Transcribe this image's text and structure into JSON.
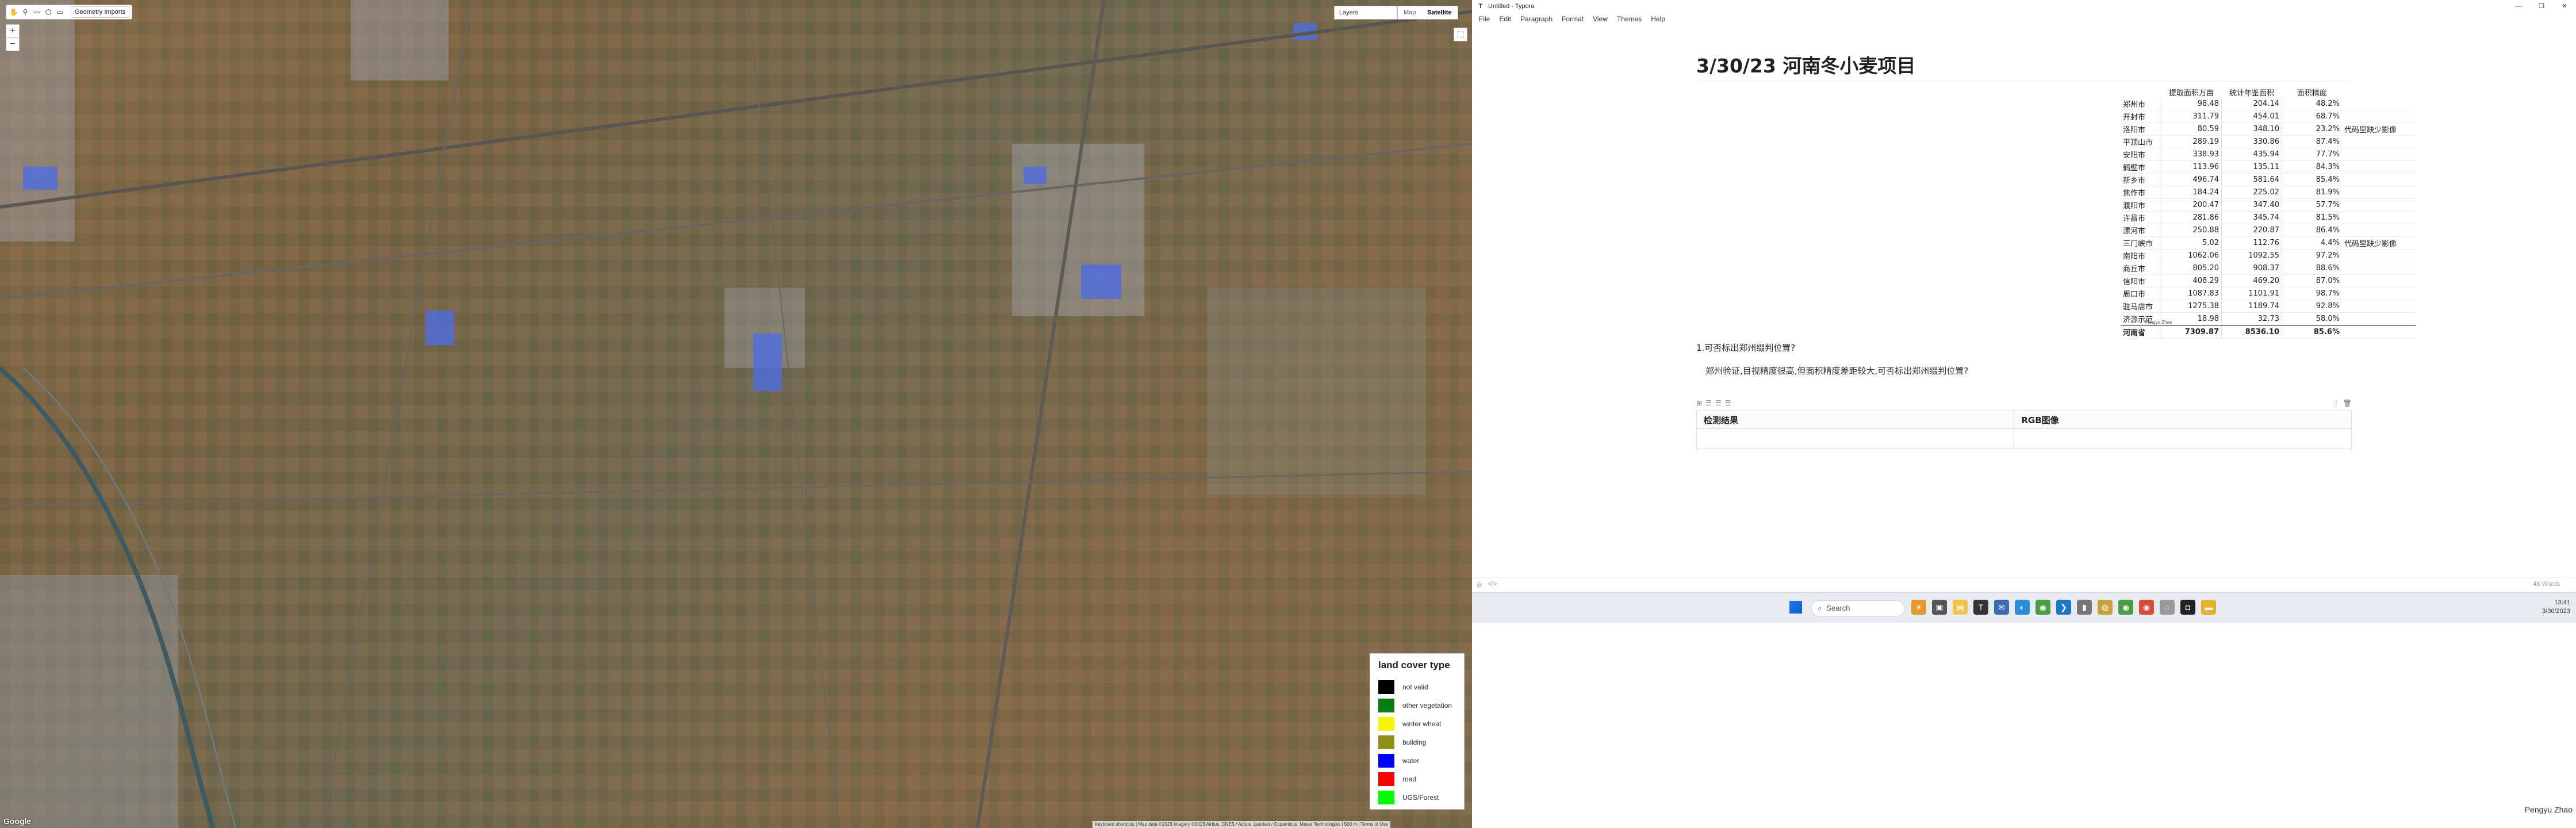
{
  "map": {
    "geometry_label": "Geometry Imports",
    "layers_label": "Layers",
    "map_label": "Map",
    "satellite_label": "Satellite",
    "zoom_in": "+",
    "zoom_out": "−",
    "google": "Google",
    "attribution": "Keyboard shortcuts | Map data ©2023 Imagery ©2023 Airbus, CNES / Airbus, Landsat / Copernicus, Maxar Technologies | 500 m | Terms of Use",
    "legend": {
      "title": "land cover type",
      "items": [
        {
          "label": "not valid",
          "color": "#000000"
        },
        {
          "label": "other vegetation",
          "color": "#0a7d12"
        },
        {
          "label": "winter wheat",
          "color": "#f5f500"
        },
        {
          "label": "building",
          "color": "#8e8e1a"
        },
        {
          "label": "water",
          "color": "#0000ff"
        },
        {
          "label": "road",
          "color": "#ff0000"
        },
        {
          "label": "UGS/Forest",
          "color": "#00ff00"
        }
      ]
    }
  },
  "typora": {
    "window_title": "Untitled - Typora",
    "menu": [
      "File",
      "Edit",
      "Paragraph",
      "Format",
      "View",
      "Themes",
      "Help"
    ],
    "doc_title": "3/30/23 河南冬小麦项目",
    "table": {
      "headers": [
        "",
        "提取面积万亩",
        "统计年鉴面积",
        "面积精度",
        ""
      ],
      "rows": [
        [
          "郑州市",
          "98.48",
          "204.14",
          "48.2%",
          ""
        ],
        [
          "开封市",
          "311.79",
          "454.01",
          "68.7%",
          ""
        ],
        [
          "洛阳市",
          "80.59",
          "348.10",
          "23.2%",
          "代码里缺少影像"
        ],
        [
          "平顶山市",
          "289.19",
          "330.86",
          "87.4%",
          ""
        ],
        [
          "安阳市",
          "338.93",
          "435.94",
          "77.7%",
          ""
        ],
        [
          "鹤壁市",
          "113.96",
          "135.11",
          "84.3%",
          ""
        ],
        [
          "新乡市",
          "496.74",
          "581.64",
          "85.4%",
          ""
        ],
        [
          "焦作市",
          "184.24",
          "225.02",
          "81.9%",
          ""
        ],
        [
          "濮阳市",
          "200.47",
          "347.40",
          "57.7%",
          ""
        ],
        [
          "许昌市",
          "281.86",
          "345.74",
          "81.5%",
          ""
        ],
        [
          "漯河市",
          "250.88",
          "220.87",
          "86.4%",
          ""
        ],
        [
          "三门峡市",
          "5.02",
          "112.76",
          "4.4%",
          "代码里缺少影像"
        ],
        [
          "南阳市",
          "1062.06",
          "1092.55",
          "97.2%",
          ""
        ],
        [
          "商丘市",
          "805.20",
          "908.37",
          "88.6%",
          ""
        ],
        [
          "信阳市",
          "408.29",
          "469.20",
          "87.0%",
          ""
        ],
        [
          "周口市",
          "1087.83",
          "1101.91",
          "98.7%",
          ""
        ],
        [
          "驻马店市",
          "1275.38",
          "1189.74",
          "92.8%",
          ""
        ],
        [
          "济源示范",
          "18.98",
          "32.73",
          "58.0%",
          ""
        ]
      ],
      "total": [
        "河南省",
        "7309.87",
        "8536.10",
        "85.6%",
        ""
      ]
    },
    "stamp": "Pengyu Zhao",
    "question": "1.可否标出郑州缀判位置?",
    "question_sub": "郑州验证,目视精度很高,但面积精度差距较大,可否标出郑州缀判位置?",
    "result_headers": [
      "检测结果",
      "RGB图像"
    ],
    "status_left": "</>",
    "status_right": "48 Words"
  },
  "taskbar": {
    "search": "Search",
    "time": "13:41",
    "date": "3/30/2023"
  },
  "username": "Pengyu Zhao"
}
